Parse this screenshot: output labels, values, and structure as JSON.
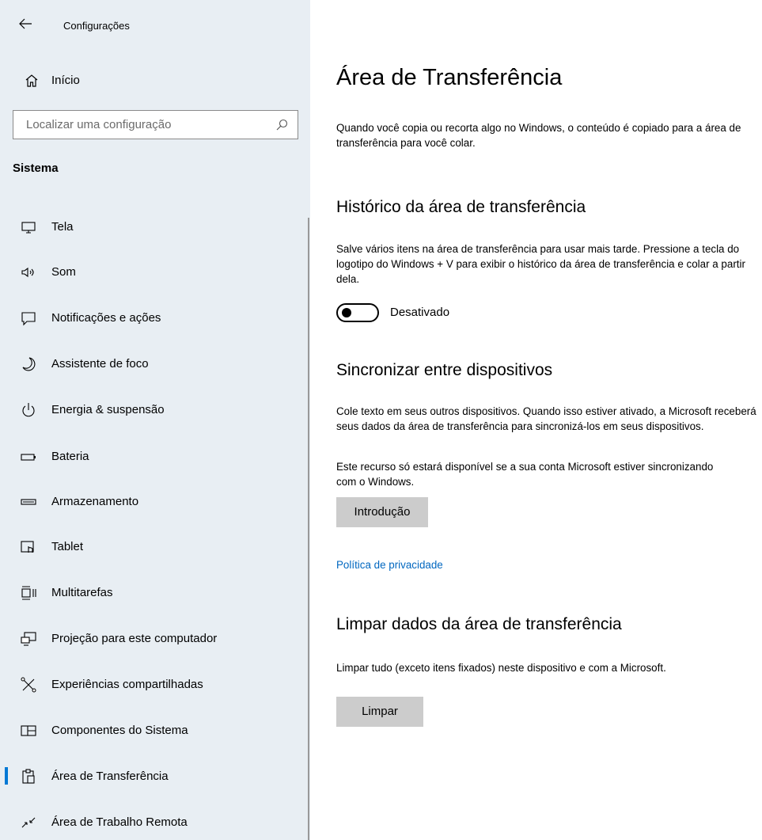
{
  "window": {
    "title": "Configurações"
  },
  "sidebar": {
    "home_label": "Início",
    "search_placeholder": "Localizar uma configuração",
    "section_title": "Sistema",
    "items": [
      {
        "label": "Tela",
        "icon": "monitor-icon"
      },
      {
        "label": "Som",
        "icon": "speaker-icon"
      },
      {
        "label": "Notificações e ações",
        "icon": "notification-icon"
      },
      {
        "label": "Assistente de foco",
        "icon": "moon-icon"
      },
      {
        "label": "Energia & suspensão",
        "icon": "power-icon"
      },
      {
        "label": "Bateria",
        "icon": "battery-icon"
      },
      {
        "label": "Armazenamento",
        "icon": "storage-icon"
      },
      {
        "label": "Tablet",
        "icon": "tablet-icon"
      },
      {
        "label": "Multitarefas",
        "icon": "multitasking-icon"
      },
      {
        "label": "Projeção para este computador",
        "icon": "projection-icon"
      },
      {
        "label": "Experiências compartilhadas",
        "icon": "shared-experiences-icon"
      },
      {
        "label": "Componentes do Sistema",
        "icon": "system-components-icon"
      },
      {
        "label": "Área de Transferência",
        "icon": "clipboard-icon",
        "selected": true
      },
      {
        "label": "Área de Trabalho Remota",
        "icon": "remote-desktop-icon"
      }
    ]
  },
  "main": {
    "title": "Área de Transferência",
    "intro": "Quando você copia ou recorta algo no Windows, o conteúdo é copiado para a área de transferência para você colar.",
    "history": {
      "heading": "Histórico da área de transferência",
      "description": "Salve vários itens na área de transferência para usar mais tarde. Pressione a tecla do logotipo do Windows + V para exibir o histórico da área de transferência e colar a partir dela.",
      "toggle_label": "Desativado",
      "toggle_on": false
    },
    "sync": {
      "heading": "Sincronizar entre dispositivos",
      "description1": "Cole texto em seus outros dispositivos. Quando isso estiver ativado, a Microsoft receberá seus dados da área de transferência para sincronizá-los em seus dispositivos.",
      "description2": "Este recurso só estará disponível se a sua conta Microsoft estiver sincronizando com o Windows.",
      "button": "Introdução",
      "privacy_link": "Política de privacidade"
    },
    "clear": {
      "heading": "Limpar dados da área de transferência",
      "description": "Limpar tudo (exceto itens fixados) neste dispositivo e com a Microsoft.",
      "button": "Limpar"
    }
  },
  "colors": {
    "sidebar_bg": "#e8eef3",
    "accent": "#0078d4",
    "link": "#0067c0",
    "button_bg": "#cccccc"
  }
}
